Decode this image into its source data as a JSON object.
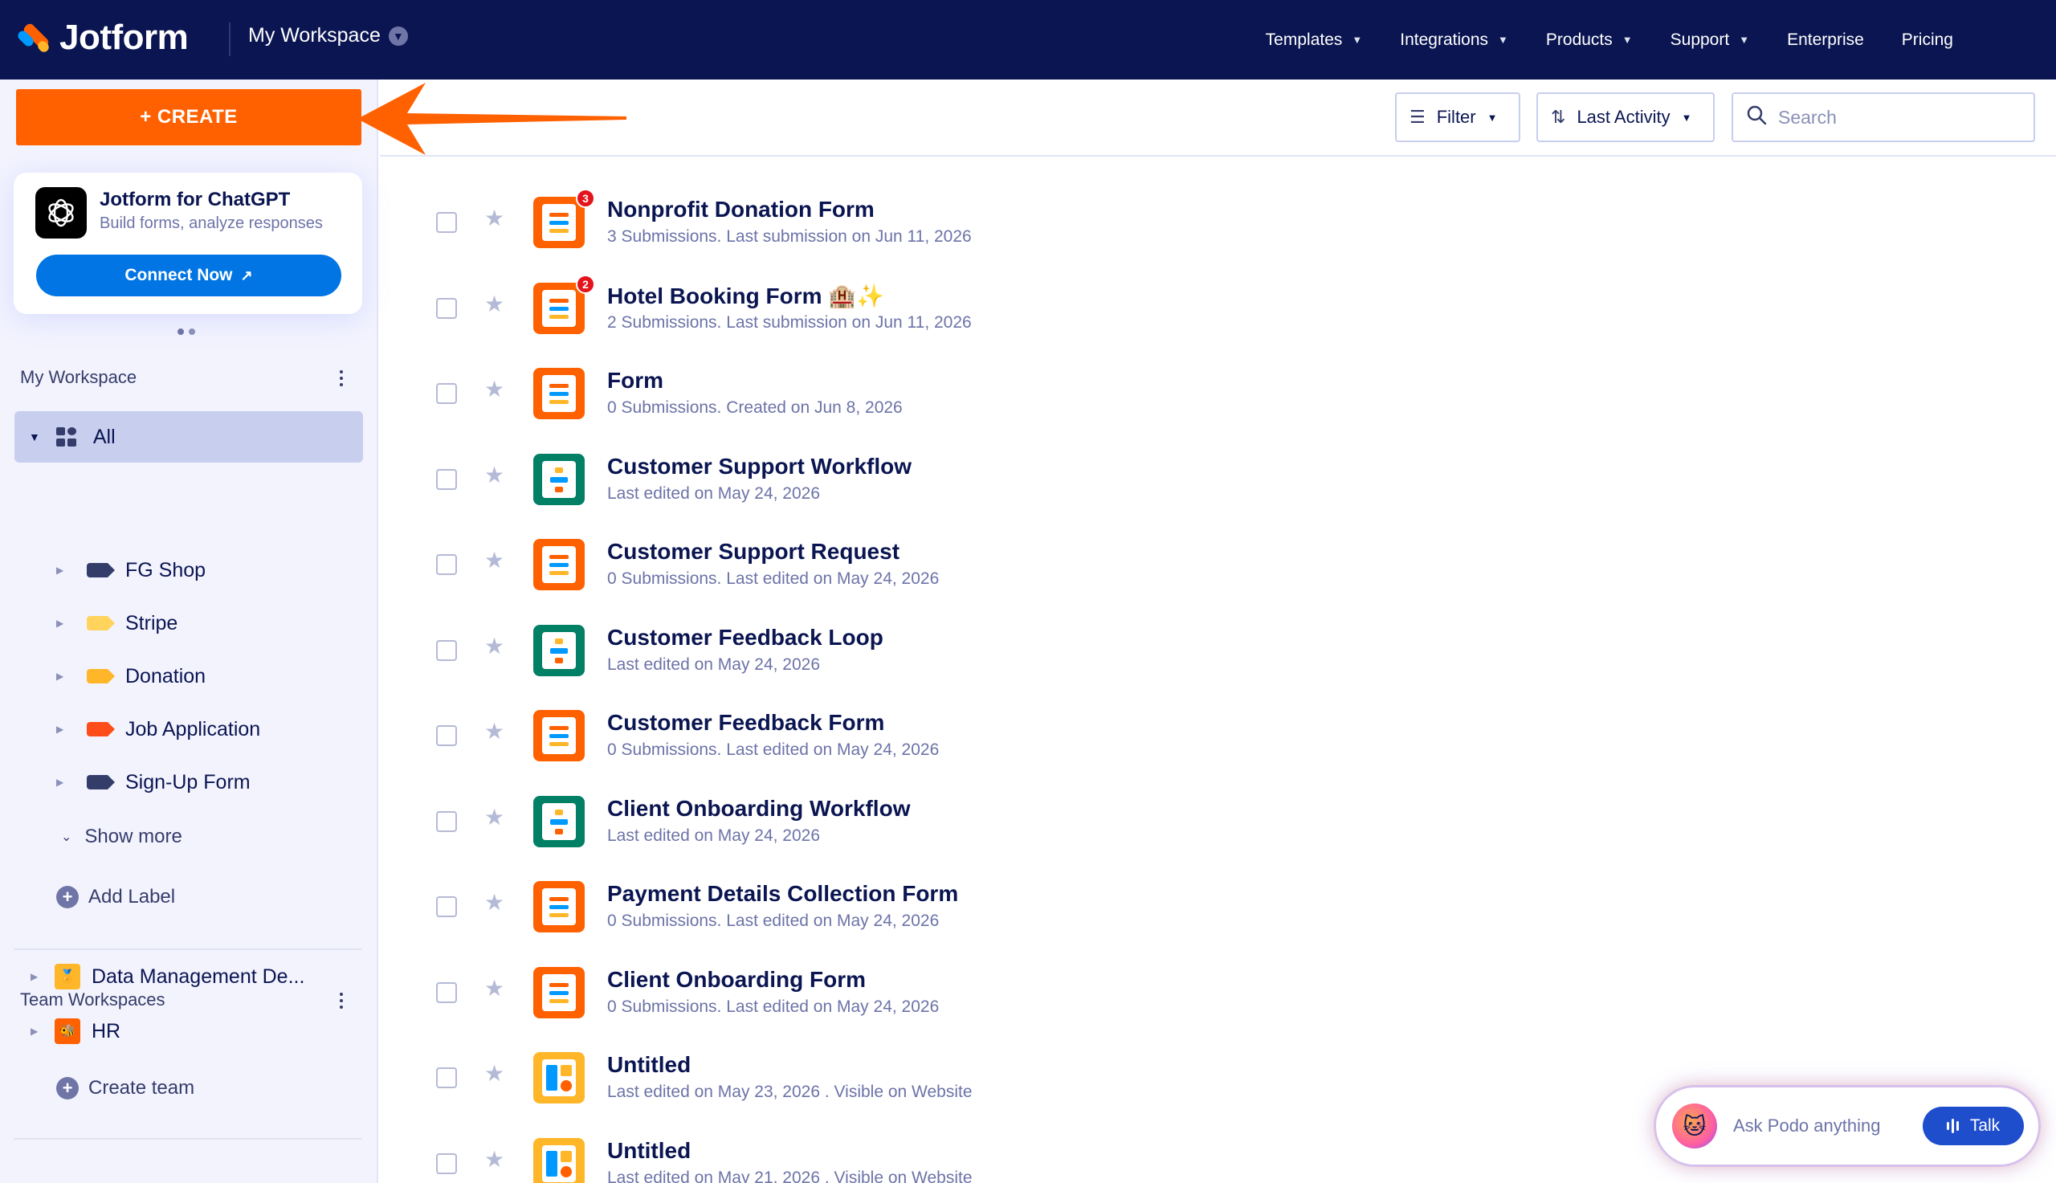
{
  "nav": {
    "brand": "Jotform",
    "workspace_label": "My Workspace",
    "links": [
      {
        "label": "Templates",
        "has_menu": true
      },
      {
        "label": "Integrations",
        "has_menu": true
      },
      {
        "label": "Products",
        "has_menu": true
      },
      {
        "label": "Support",
        "has_menu": true
      },
      {
        "label": "Enterprise",
        "has_menu": false
      },
      {
        "label": "Pricing",
        "has_menu": false
      }
    ]
  },
  "sidebar": {
    "create_label": "+ CREATE",
    "promo": {
      "title": "Jotform for ChatGPT",
      "subtitle": "Build forms, analyze responses",
      "button": "Connect Now"
    },
    "my_workspace_title": "My Workspace",
    "all_label": "All",
    "labels": [
      {
        "name": "FG Shop",
        "color": "#343c6a"
      },
      {
        "name": "Stripe",
        "color": "#ffd35c"
      },
      {
        "name": "Donation",
        "color": "#ffb629"
      },
      {
        "name": "Job Application",
        "color": "#ff4d1a"
      },
      {
        "name": "Sign-Up Form",
        "color": "#343c6a"
      }
    ],
    "show_more": "Show more",
    "add_label": "Add Label",
    "team_title": "Team Workspaces",
    "teams": [
      {
        "name": "Data Management De...",
        "color": "#ffb629",
        "icon": "🏅"
      },
      {
        "name": "HR",
        "color": "#ff6100",
        "icon": "🐝"
      }
    ],
    "create_team": "Create team"
  },
  "toolbar": {
    "filter_label": "Filter",
    "sort_label": "Last Activity",
    "search_placeholder": "Search"
  },
  "forms": [
    {
      "title": "Nonprofit Donation Form",
      "meta": "3 Submissions. Last submission on Jun 11, 2026",
      "type": "form",
      "color": "orange",
      "badge": "3"
    },
    {
      "title": "Hotel Booking Form 🏨✨",
      "meta": "2 Submissions. Last submission on Jun 11, 2026",
      "type": "form",
      "color": "orange",
      "badge": "2"
    },
    {
      "title": "Form",
      "meta": "0 Submissions. Created on Jun 8, 2026",
      "type": "form",
      "color": "orange",
      "badge": ""
    },
    {
      "title": "Customer Support Workflow",
      "meta": "Last edited on May 24, 2026",
      "type": "flow",
      "color": "green",
      "badge": ""
    },
    {
      "title": "Customer Support Request",
      "meta": "0 Submissions. Last edited on May 24, 2026",
      "type": "form",
      "color": "orange",
      "badge": ""
    },
    {
      "title": "Customer Feedback Loop",
      "meta": "Last edited on May 24, 2026",
      "type": "flow",
      "color": "green",
      "badge": ""
    },
    {
      "title": "Customer Feedback Form",
      "meta": "0 Submissions. Last edited on May 24, 2026",
      "type": "form",
      "color": "orange",
      "badge": ""
    },
    {
      "title": "Client Onboarding Workflow",
      "meta": "Last edited on May 24, 2026",
      "type": "flow",
      "color": "green",
      "badge": ""
    },
    {
      "title": "Payment Details Collection Form",
      "meta": "0 Submissions. Last edited on May 24, 2026",
      "type": "form",
      "color": "orange",
      "badge": ""
    },
    {
      "title": "Client Onboarding Form",
      "meta": "0 Submissions. Last edited on May 24, 2026",
      "type": "form",
      "color": "orange",
      "badge": ""
    },
    {
      "title": "Untitled",
      "meta": "Last edited on May 23, 2026 . Visible on Website",
      "type": "app",
      "color": "yellow",
      "badge": ""
    },
    {
      "title": "Untitled",
      "meta": "Last edited on May 21, 2026 . Visible on Website",
      "type": "app",
      "color": "yellow",
      "badge": ""
    }
  ],
  "podo": {
    "placeholder": "Ask Podo anything",
    "talk_label": "Talk"
  }
}
